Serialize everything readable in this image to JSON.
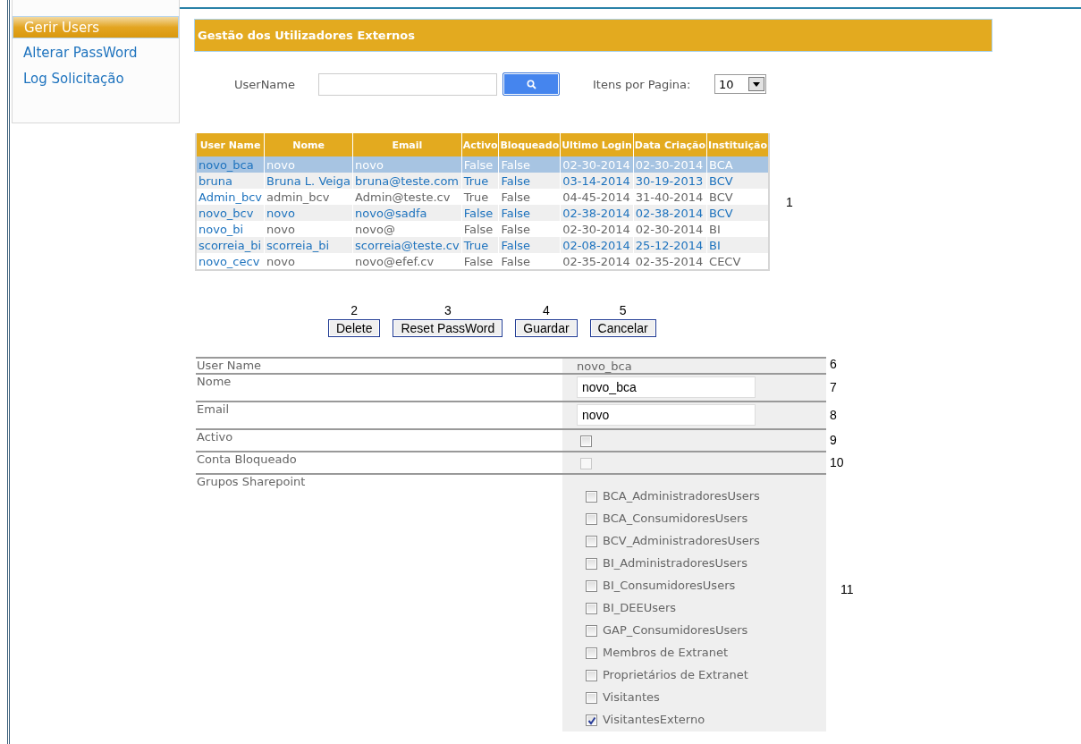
{
  "sidebar": {
    "items": [
      {
        "label": "Gerir Users",
        "selected": true
      },
      {
        "label": "Alterar PassWord",
        "selected": false
      },
      {
        "label": "Log Solicitação",
        "selected": false
      }
    ]
  },
  "header": {
    "title": "Gestão dos Utilizadores Externos"
  },
  "search": {
    "label": "UserName"
  },
  "page_size": {
    "label": "Itens por Pagina:",
    "value": "10"
  },
  "users": {
    "annotation": "1",
    "columns": [
      "User Name",
      "Nome",
      "Email",
      "Activo",
      "Bloqueado",
      "Ultimo Login",
      "Data Criação",
      "Instituição"
    ],
    "rows": [
      {
        "selected": true,
        "cells": [
          "novo_bca",
          "novo",
          "novo",
          "False",
          "False",
          "02-30-2014",
          "02-30-2014",
          "BCA"
        ]
      },
      {
        "selected": false,
        "cells": [
          "bruna",
          "Bruna L. Veiga",
          "bruna@teste.com",
          "True",
          "False",
          "03-14-2014",
          "30-19-2013",
          "BCV"
        ]
      },
      {
        "selected": false,
        "cells": [
          "Admin_bcv",
          "admin_bcv",
          "Admin@teste.cv",
          "True",
          "False",
          "04-45-2014",
          "31-40-2014",
          "BCV"
        ]
      },
      {
        "selected": false,
        "cells": [
          "novo_bcv",
          "novo",
          "novo@sadfa",
          "False",
          "False",
          "02-38-2014",
          "02-38-2014",
          "BCV"
        ]
      },
      {
        "selected": false,
        "cells": [
          "novo_bi",
          "novo",
          "novo@",
          "False",
          "False",
          "02-30-2014",
          "02-30-2014",
          "BI"
        ]
      },
      {
        "selected": false,
        "cells": [
          "scorreia_bi",
          "scorreia_bi",
          "scorreia@teste.cv",
          "True",
          "False",
          "02-08-2014",
          "25-12-2014",
          "BI"
        ]
      },
      {
        "selected": false,
        "cells": [
          "novo_cecv",
          "novo",
          "novo@efef.cv",
          "False",
          "False",
          "02-35-2014",
          "02-35-2014",
          "CECV"
        ]
      }
    ]
  },
  "actions": [
    {
      "label": "Delete",
      "annotation": "2"
    },
    {
      "label": "Reset PassWord",
      "annotation": "3"
    },
    {
      "label": "Guardar",
      "annotation": "4"
    },
    {
      "label": "Cancelar",
      "annotation": "5"
    }
  ],
  "form": {
    "fields": [
      {
        "kind": "readonly",
        "label": "User Name",
        "value": "novo_bca",
        "annotation": "6"
      },
      {
        "kind": "text",
        "label": "Nome",
        "value": "novo_bca",
        "annotation": "7"
      },
      {
        "kind": "text",
        "label": "Email",
        "value": "novo",
        "annotation": "8"
      },
      {
        "kind": "checkbox",
        "label": "Activo",
        "checked": false,
        "disabled": false,
        "annotation": "9"
      },
      {
        "kind": "checkbox",
        "label": "Conta Bloqueado",
        "checked": false,
        "disabled": true,
        "annotation": "10"
      },
      {
        "kind": "groups",
        "label": "Grupos Sharepoint",
        "annotation": "11",
        "options": [
          {
            "label": "BCA_AdministradoresUsers",
            "checked": false
          },
          {
            "label": "BCA_ConsumidoresUsers",
            "checked": false
          },
          {
            "label": "BCV_AdministradoresUsers",
            "checked": false
          },
          {
            "label": "BI_AdministradoresUsers",
            "checked": false
          },
          {
            "label": "BI_ConsumidoresUsers",
            "checked": false
          },
          {
            "label": "BI_DEEUsers",
            "checked": false
          },
          {
            "label": "GAP_ConsumidoresUsers",
            "checked": false
          },
          {
            "label": "Membros de Extranet",
            "checked": false
          },
          {
            "label": "Proprietários de Extranet",
            "checked": false
          },
          {
            "label": "Visitantes",
            "checked": false
          },
          {
            "label": "VisitantesExterno",
            "checked": true
          }
        ]
      }
    ]
  }
}
